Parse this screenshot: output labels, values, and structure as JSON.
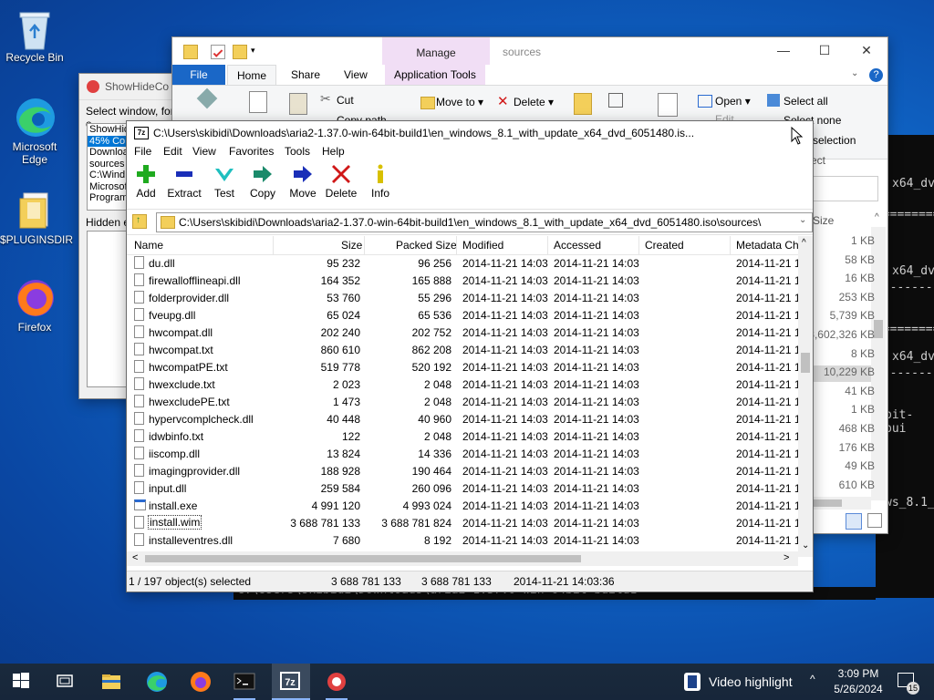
{
  "desktop": {
    "icons": [
      {
        "label": "Recycle Bin",
        "icon": "recycle-bin-icon"
      },
      {
        "label": "Microsoft Edge",
        "icon": "edge-icon"
      },
      {
        "label": "$PLUGINSDIR",
        "icon": "folder-icon"
      },
      {
        "label": "Firefox",
        "icon": "firefox-icon"
      }
    ]
  },
  "showhide": {
    "title": "ShowHideCo",
    "prompt": "Select window, for e",
    "list": [
      "ShowHid",
      "45% Co",
      "Downloa",
      "sources",
      "C:\\Wind",
      "Microsof",
      "Program"
    ],
    "hidden_label": "Hidden el"
  },
  "explorer": {
    "manage_tab": "Manage",
    "title": "sources",
    "tabs": [
      "File",
      "Home",
      "Share",
      "View",
      "Application Tools"
    ],
    "ribbon": {
      "cut": "Cut",
      "copy_path": "Copy path",
      "move_to": "Move to",
      "delete": "Delete",
      "open": "Open",
      "edit": "Edit",
      "select_all": "Select all",
      "select_none": "Select none",
      "invert_selection": "selection",
      "select_group": "ect"
    },
    "size_header": "Size",
    "sizes": [
      "1 KB",
      "58 KB",
      "16 KB",
      "253 KB",
      "5,739 KB",
      "3,602,326 KB",
      "8 KB",
      "10,229 KB",
      "41 KB",
      "1 KB",
      "468 KB",
      "176 KB",
      "49 KB",
      "610 KB"
    ]
  },
  "terminal": {
    "fragments": [
      "x64_dv",
      "==========",
      "x64_dv",
      "----------",
      "==========",
      "x64_dv",
      "----------",
      "bit-bui",
      "ws_8.1_"
    ],
    "bottom_line": "C:\\Users\\skibidi\\Downloads\\aria2-1.37.0-win-64bit-build1>"
  },
  "sevenzip": {
    "title": "C:\\Users\\skibidi\\Downloads\\aria2-1.37.0-win-64bit-build1\\en_windows_8.1_with_update_x64_dvd_6051480.is...",
    "menu": [
      "File",
      "Edit",
      "View",
      "Favorites",
      "Tools",
      "Help"
    ],
    "toolbar": [
      {
        "label": "Add",
        "icon": "add-plus-icon",
        "color": "#1faa1f"
      },
      {
        "label": "Extract",
        "icon": "extract-minus-icon",
        "color": "#1a2fb8"
      },
      {
        "label": "Test",
        "icon": "test-check-icon",
        "color": "#1fbfbf"
      },
      {
        "label": "Copy",
        "icon": "copy-arrow-icon",
        "color": "#1a8a6a"
      },
      {
        "label": "Move",
        "icon": "move-arrow-icon",
        "color": "#1a2fb8"
      },
      {
        "label": "Delete",
        "icon": "delete-x-icon",
        "color": "#d01818"
      },
      {
        "label": "Info",
        "icon": "info-icon",
        "color": "#d8c000"
      }
    ],
    "address": "C:\\Users\\skibidi\\Downloads\\aria2-1.37.0-win-64bit-build1\\en_windows_8.1_with_update_x64_dvd_6051480.iso\\sources\\",
    "columns": [
      "Name",
      "Size",
      "Packed Size",
      "Modified",
      "Accessed",
      "Created",
      "Metadata Ch"
    ],
    "rows": [
      {
        "name": "du.dll",
        "size": "95 232",
        "packed": "96 256",
        "modified": "2014-11-21 14:03",
        "accessed": "2014-11-21 14:03",
        "created": "",
        "meta": "2014-11-21 1"
      },
      {
        "name": "firewallofflineapi.dll",
        "size": "164 352",
        "packed": "165 888",
        "modified": "2014-11-21 14:03",
        "accessed": "2014-11-21 14:03",
        "created": "",
        "meta": "2014-11-21 1"
      },
      {
        "name": "folderprovider.dll",
        "size": "53 760",
        "packed": "55 296",
        "modified": "2014-11-21 14:03",
        "accessed": "2014-11-21 14:03",
        "created": "",
        "meta": "2014-11-21 1"
      },
      {
        "name": "fveupg.dll",
        "size": "65 024",
        "packed": "65 536",
        "modified": "2014-11-21 14:03",
        "accessed": "2014-11-21 14:03",
        "created": "",
        "meta": "2014-11-21 1"
      },
      {
        "name": "hwcompat.dll",
        "size": "202 240",
        "packed": "202 752",
        "modified": "2014-11-21 14:03",
        "accessed": "2014-11-21 14:03",
        "created": "",
        "meta": "2014-11-21 1"
      },
      {
        "name": "hwcompat.txt",
        "size": "860 610",
        "packed": "862 208",
        "modified": "2014-11-21 14:03",
        "accessed": "2014-11-21 14:03",
        "created": "",
        "meta": "2014-11-21 1"
      },
      {
        "name": "hwcompatPE.txt",
        "size": "519 778",
        "packed": "520 192",
        "modified": "2014-11-21 14:03",
        "accessed": "2014-11-21 14:03",
        "created": "",
        "meta": "2014-11-21 1"
      },
      {
        "name": "hwexclude.txt",
        "size": "2 023",
        "packed": "2 048",
        "modified": "2014-11-21 14:03",
        "accessed": "2014-11-21 14:03",
        "created": "",
        "meta": "2014-11-21 1"
      },
      {
        "name": "hwexcludePE.txt",
        "size": "1 473",
        "packed": "2 048",
        "modified": "2014-11-21 14:03",
        "accessed": "2014-11-21 14:03",
        "created": "",
        "meta": "2014-11-21 1"
      },
      {
        "name": "hypervcomplcheck.dll",
        "size": "40 448",
        "packed": "40 960",
        "modified": "2014-11-21 14:03",
        "accessed": "2014-11-21 14:03",
        "created": "",
        "meta": "2014-11-21 1"
      },
      {
        "name": "idwbinfo.txt",
        "size": "122",
        "packed": "2 048",
        "modified": "2014-11-21 14:03",
        "accessed": "2014-11-21 14:03",
        "created": "",
        "meta": "2014-11-21 1"
      },
      {
        "name": "iiscomp.dll",
        "size": "13 824",
        "packed": "14 336",
        "modified": "2014-11-21 14:03",
        "accessed": "2014-11-21 14:03",
        "created": "",
        "meta": "2014-11-21 1"
      },
      {
        "name": "imagingprovider.dll",
        "size": "188 928",
        "packed": "190 464",
        "modified": "2014-11-21 14:03",
        "accessed": "2014-11-21 14:03",
        "created": "",
        "meta": "2014-11-21 1"
      },
      {
        "name": "input.dll",
        "size": "259 584",
        "packed": "260 096",
        "modified": "2014-11-21 14:03",
        "accessed": "2014-11-21 14:03",
        "created": "",
        "meta": "2014-11-21 1"
      },
      {
        "name": "install.exe",
        "size": "4 991 120",
        "packed": "4 993 024",
        "modified": "2014-11-21 14:03",
        "accessed": "2014-11-21 14:03",
        "created": "",
        "meta": "2014-11-21 1"
      },
      {
        "name": "install.wim",
        "size": "3 688 781 133",
        "packed": "3 688 781 824",
        "modified": "2014-11-21 14:03",
        "accessed": "2014-11-21 14:03",
        "created": "",
        "meta": "2014-11-21 1"
      },
      {
        "name": "installeventres.dll",
        "size": "7 680",
        "packed": "8 192",
        "modified": "2014-11-21 14:03",
        "accessed": "2014-11-21 14:03",
        "created": "",
        "meta": "2014-11-21 1"
      }
    ],
    "status": {
      "selected": "1 / 197 object(s) selected",
      "size": "3 688 781 133",
      "packed": "3 688 781 133",
      "modified": "2014-11-21 14:03:36"
    }
  },
  "taskbar": {
    "apps": [
      "start-icon",
      "task-view-icon",
      "file-explorer-icon",
      "edge-icon",
      "firefox-icon",
      "terminal-icon",
      "7zip-icon",
      "showhide-icon"
    ],
    "news": "Video highlight",
    "time": "3:09 PM",
    "date": "5/26/2024",
    "notification_count": "15"
  }
}
